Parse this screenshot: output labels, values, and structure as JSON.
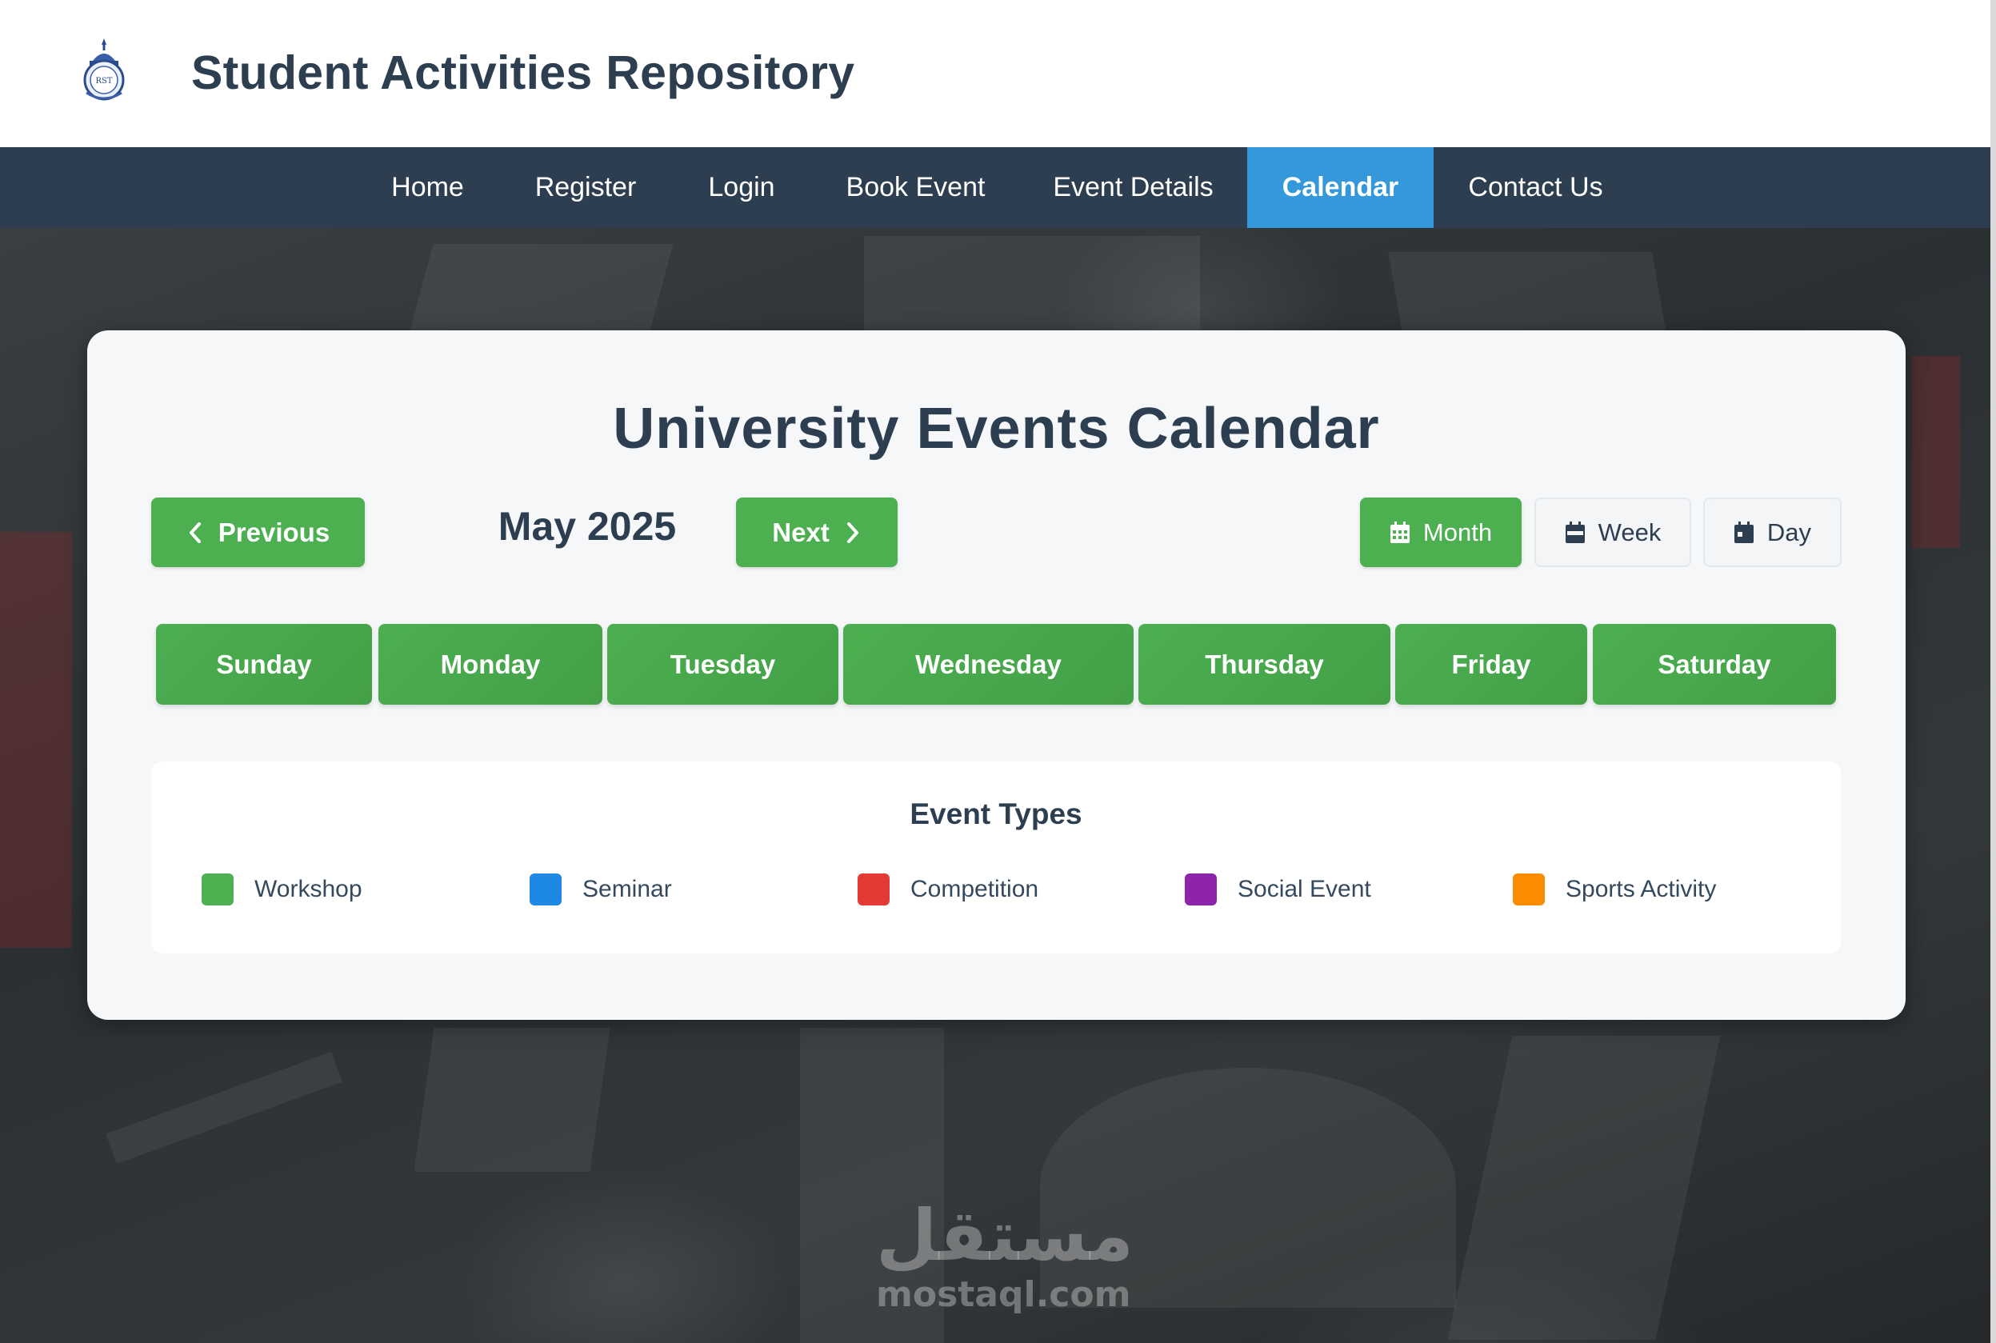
{
  "site": {
    "title": "Student Activities Repository",
    "logo_text": "RST"
  },
  "nav": {
    "items": [
      {
        "label": "Home",
        "active": false
      },
      {
        "label": "Register",
        "active": false
      },
      {
        "label": "Login",
        "active": false
      },
      {
        "label": "Book Event",
        "active": false
      },
      {
        "label": "Event Details",
        "active": false
      },
      {
        "label": "Calendar",
        "active": true
      },
      {
        "label": "Contact Us",
        "active": false
      }
    ]
  },
  "calendar": {
    "title": "University Events Calendar",
    "current_month": "May 2025",
    "prev_label": "Previous",
    "next_label": "Next",
    "views": [
      {
        "label": "Month",
        "icon": "calendar-grid-icon",
        "active": true
      },
      {
        "label": "Week",
        "icon": "calendar-week-icon",
        "active": false
      },
      {
        "label": "Day",
        "icon": "calendar-day-icon",
        "active": false
      }
    ],
    "weekdays": [
      "Sunday",
      "Monday",
      "Tuesday",
      "Wednesday",
      "Thursday",
      "Friday",
      "Saturday"
    ]
  },
  "legend": {
    "title": "Event Types",
    "items": [
      {
        "label": "Workshop",
        "color": "#4caf50"
      },
      {
        "label": "Seminar",
        "color": "#1e88e5"
      },
      {
        "label": "Competition",
        "color": "#e53935"
      },
      {
        "label": "Social Event",
        "color": "#8e24aa"
      },
      {
        "label": "Sports Activity",
        "color": "#fb8c00"
      }
    ]
  },
  "watermark": {
    "arabic": "مستقل",
    "latin": "mostaql.com"
  },
  "colors": {
    "primary": "#2c3e50",
    "accent": "#3498db",
    "green": "#4caf50"
  }
}
